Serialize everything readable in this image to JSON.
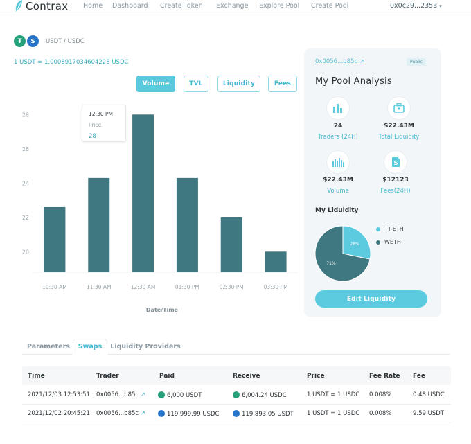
{
  "brand": {
    "name": "Contrax"
  },
  "nav": {
    "links": [
      "Home",
      "Dashboard",
      "Create Token",
      "Exchange",
      "Explore Pool",
      "Create Pool"
    ],
    "wallet": "0x0c29...2353"
  },
  "pair": {
    "name": "USDT / USDC",
    "rate": "1 USDT = 1.0008917034604228 USDC",
    "token_a_color": "#26a17b",
    "token_b_color": "#2775ca"
  },
  "metric_buttons": {
    "active": "Volume",
    "labels": [
      "Volume",
      "TVL",
      "Liquidity",
      "Fees"
    ]
  },
  "tooltip": {
    "time": "12:30 PM",
    "label": "Price",
    "value": "28"
  },
  "chart_data": {
    "type": "bar",
    "categories": [
      "10:30 AM",
      "11:30 AM",
      "12:30 AM",
      "01:30 PM",
      "02:30 PM",
      "03:30 PM"
    ],
    "values": [
      22.6,
      24.3,
      28,
      24.3,
      22,
      20
    ],
    "yticks": [
      20,
      22,
      24,
      26,
      28
    ],
    "ylim": [
      18.8,
      28.9
    ],
    "xlabel": "Date/Time",
    "grid": false,
    "bar_color": "#3f7880"
  },
  "panel": {
    "address": "0x0056...b85c",
    "badge": "Public",
    "title": "My Pool Analysis",
    "stats": [
      {
        "value": "24",
        "label": "Traders (24H)",
        "icon": "bar-chart-icon"
      },
      {
        "value": "$22.43M",
        "label": "Total Liquidity",
        "icon": "briefcase-icon"
      },
      {
        "value": "$22.43M",
        "label": "Volume",
        "icon": "histogram-icon"
      },
      {
        "value": "$12123",
        "label": "Fees(24H)",
        "icon": "dollar-document-icon"
      }
    ],
    "liquidity_title": "My Liduidity",
    "pie": [
      {
        "name": "TT-ETH",
        "percent": 28,
        "label": "28%",
        "color": "#5ccbe0"
      },
      {
        "name": "WETH",
        "percent": 71,
        "label": "71%",
        "color": "#3f7880"
      }
    ],
    "edit_button": "Edit Liquidity"
  },
  "tabs": {
    "labels": [
      "Parameters",
      "Swaps",
      "Liquidity Providers"
    ],
    "active": "Swaps"
  },
  "table": {
    "headers": [
      "Time",
      "Trader",
      "Paid",
      "Receive",
      "Price",
      "Fee Rate",
      "Fee"
    ],
    "rows": [
      {
        "time": "2021/12/03 12:53:51",
        "trader": "0x0056...b85c",
        "paid": "6,000 USDT",
        "receive": "6,004.24 USDC",
        "price": "1 USDT = 1 USDC",
        "fee_rate": "0.008%",
        "fee": "0.48 USDC",
        "paid_coin": "usdt",
        "receive_coin": "usdt"
      },
      {
        "time": "2021/12/02 20:45:21",
        "trader": "0x0056...b85c",
        "paid": "119,999.99 USDC",
        "receive": "119,893.05 USDT",
        "price": "1 USDT = 1 USDC",
        "fee_rate": "0.008%",
        "fee": "9.59 USDT",
        "paid_coin": "usdc",
        "receive_coin": "usdc"
      }
    ]
  }
}
